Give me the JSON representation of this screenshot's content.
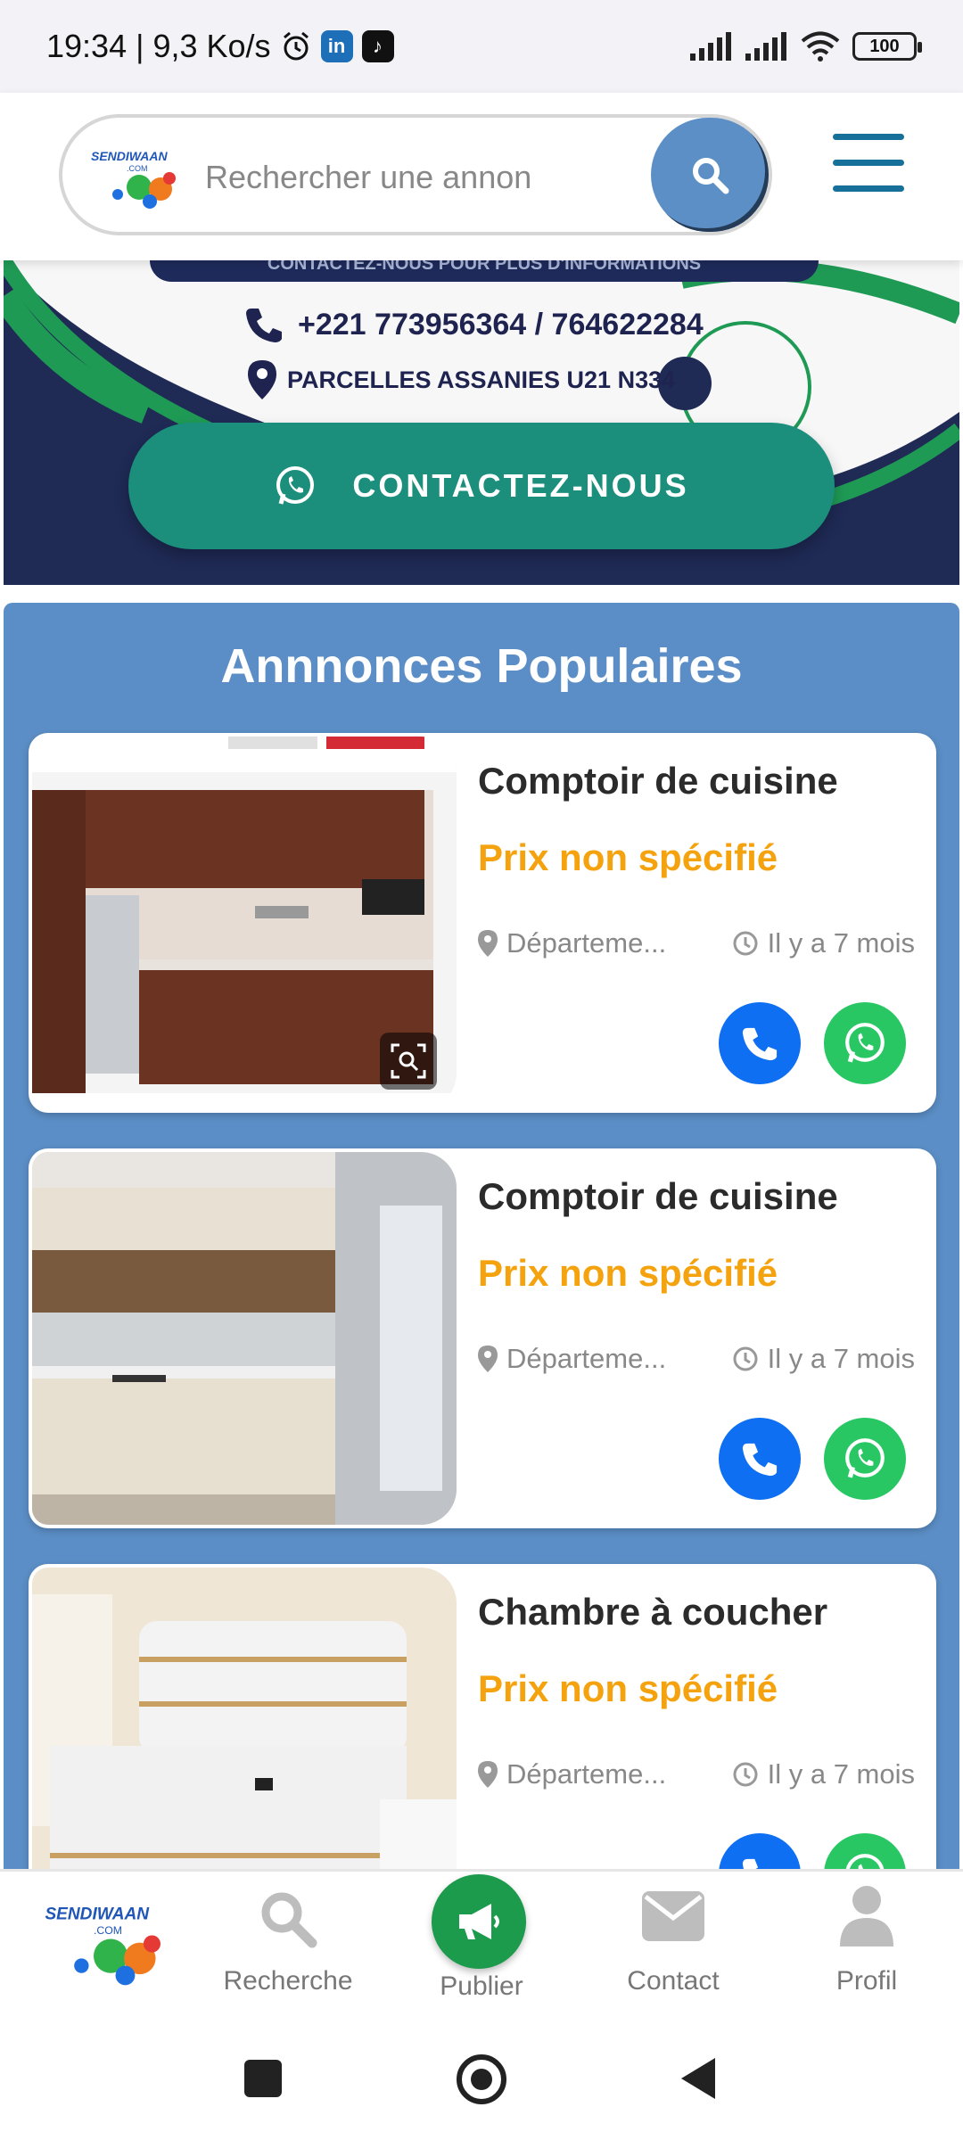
{
  "status_bar": {
    "time_speed": "19:34 | 9,3 Ko/s",
    "battery": "100"
  },
  "header": {
    "logo_text": "SENDIWAAN",
    "logo_sub": ".COM",
    "search_placeholder": "Rechercher une annon"
  },
  "banner": {
    "top_strip": "CONTACTEZ-NOUS POUR PLUS D'INFORMATIONS",
    "phone": "+221 773956364 / 764622284",
    "address": "PARCELLES ASSANIES U21 N334",
    "contact_button": "CONTACTEZ-NOUS"
  },
  "popular": {
    "title": "Annnonces Populaires",
    "listings": [
      {
        "title": "Comptoir de cuisine",
        "price": "Prix non spécifié",
        "location": "Départeme...",
        "time": "Il y a 7 mois"
      },
      {
        "title": "Comptoir de cuisine",
        "price": "Prix non spécifié",
        "location": "Départeme...",
        "time": "Il y a 7 mois"
      },
      {
        "title": "Chambre à coucher",
        "price": "Prix non spécifié",
        "location": "Départeme...",
        "time": "Il y a 7 mois"
      }
    ]
  },
  "bottom_nav": {
    "search": "Recherche",
    "publish": "Publier",
    "contact": "Contact",
    "profile": "Profil"
  },
  "colors": {
    "accent_blue": "#5b8ec6",
    "price_orange": "#f5a20f",
    "contact_green": "#1b8e7c",
    "call_blue": "#0e6ff2",
    "whatsapp_green": "#28c764"
  }
}
